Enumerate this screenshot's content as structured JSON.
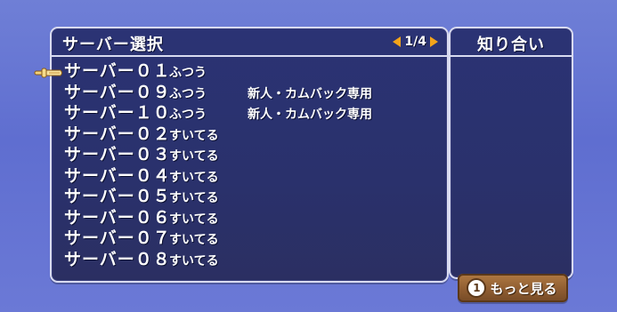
{
  "server_panel": {
    "title": "サーバー選択",
    "page_label": "1/4"
  },
  "friends_panel": {
    "title": "知り合い"
  },
  "servers": [
    {
      "name": "サーバー０１",
      "status": "ふつう",
      "note": ""
    },
    {
      "name": "サーバー０９",
      "status": "ふつう",
      "note": "新人・カムバック専用"
    },
    {
      "name": "サーバー１０",
      "status": "ふつう",
      "note": "新人・カムバック専用"
    },
    {
      "name": "サーバー０２",
      "status": "すいてる",
      "note": ""
    },
    {
      "name": "サーバー０３",
      "status": "すいてる",
      "note": ""
    },
    {
      "name": "サーバー０４",
      "status": "すいてる",
      "note": ""
    },
    {
      "name": "サーバー０５",
      "status": "すいてる",
      "note": ""
    },
    {
      "name": "サーバー０６",
      "status": "すいてる",
      "note": ""
    },
    {
      "name": "サーバー０７",
      "status": "すいてる",
      "note": ""
    },
    {
      "name": "サーバー０８",
      "status": "すいてる",
      "note": ""
    }
  ],
  "more_button": {
    "badge": "1",
    "label": "もっと見る"
  },
  "icons": {
    "page_prev": "arrow-left-icon",
    "page_next": "arrow-right-icon",
    "cursor": "pointing-hand-cursor-icon"
  },
  "colors": {
    "background": "#6f7fd6",
    "panel": "#2b3374",
    "border": "#d9dbf0",
    "arrow_accent": "#f3a41a",
    "button": "#8f5d31"
  }
}
